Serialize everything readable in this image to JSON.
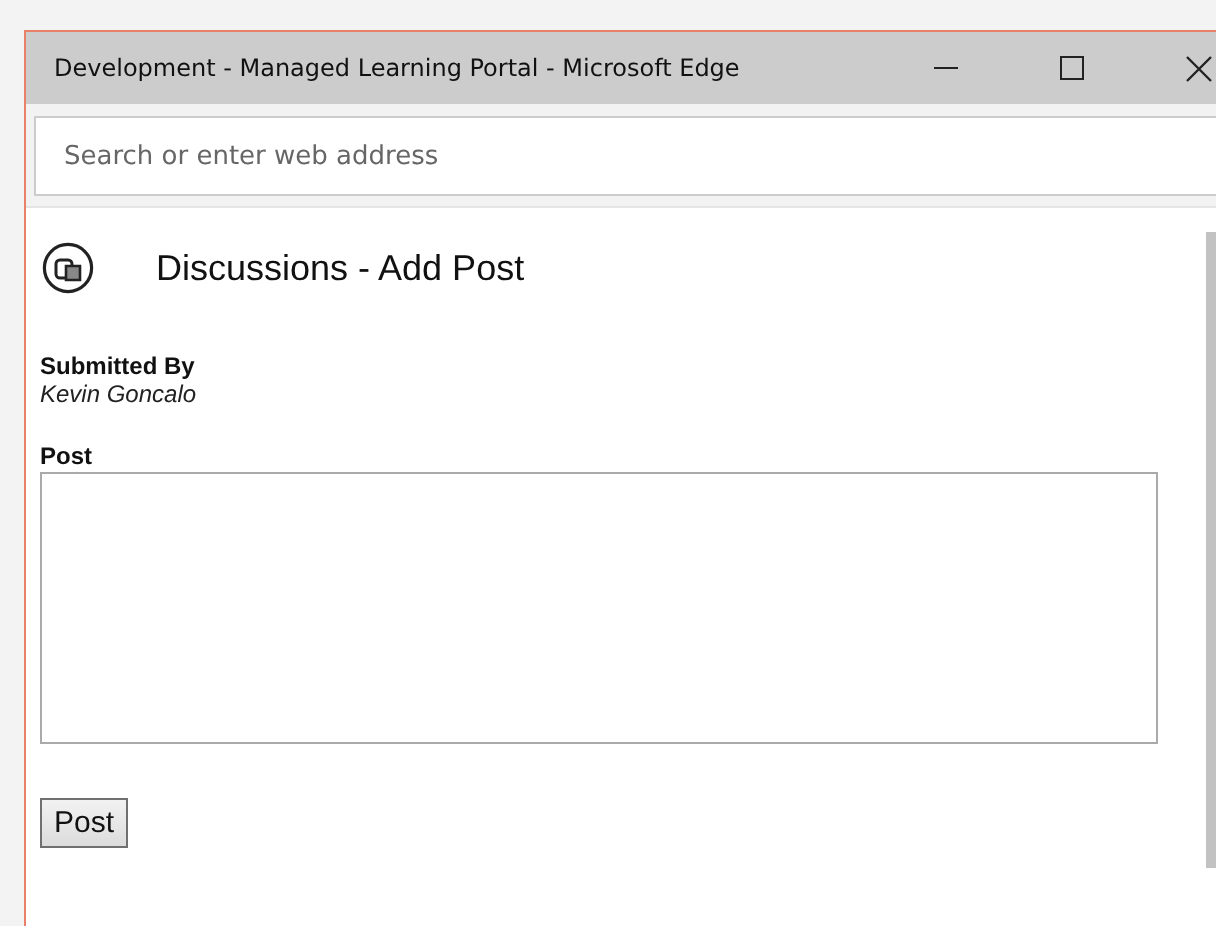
{
  "window": {
    "title": "Development - Managed Learning Portal - Microsoft Edge"
  },
  "address_bar": {
    "placeholder": "Search or enter web address"
  },
  "page": {
    "heading": "Discussions - Add Post",
    "submitted_by": {
      "label": "Submitted By",
      "value": "Kevin Goncalo"
    },
    "post": {
      "label": "Post"
    },
    "buttons": [
      "Post"
    ]
  }
}
